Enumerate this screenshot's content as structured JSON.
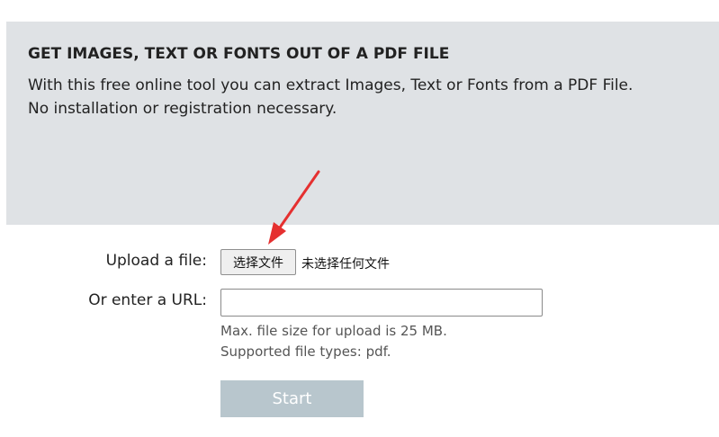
{
  "banner": {
    "title": "GET IMAGES, TEXT OR FONTS OUT OF A PDF FILE",
    "description_line1": "With this free online tool you can extract Images, Text or Fonts from a PDF File.",
    "description_line2": "No installation or registration necessary."
  },
  "form": {
    "upload_label": "Upload a file:",
    "file_button_label": "选择文件",
    "file_status": "未选择任何文件",
    "url_label": "Or enter a URL:",
    "url_value": "",
    "max_size_hint": "Max. file size for upload is 25 MB.",
    "file_types_hint": "Supported file types: pdf.",
    "start_label": "Start"
  },
  "colors": {
    "banner_background": "#dfe2e5",
    "start_button_background": "#b8c6cd",
    "annotation_arrow": "#e53030"
  },
  "icons": {
    "annotation": "red-arrow-icon"
  }
}
